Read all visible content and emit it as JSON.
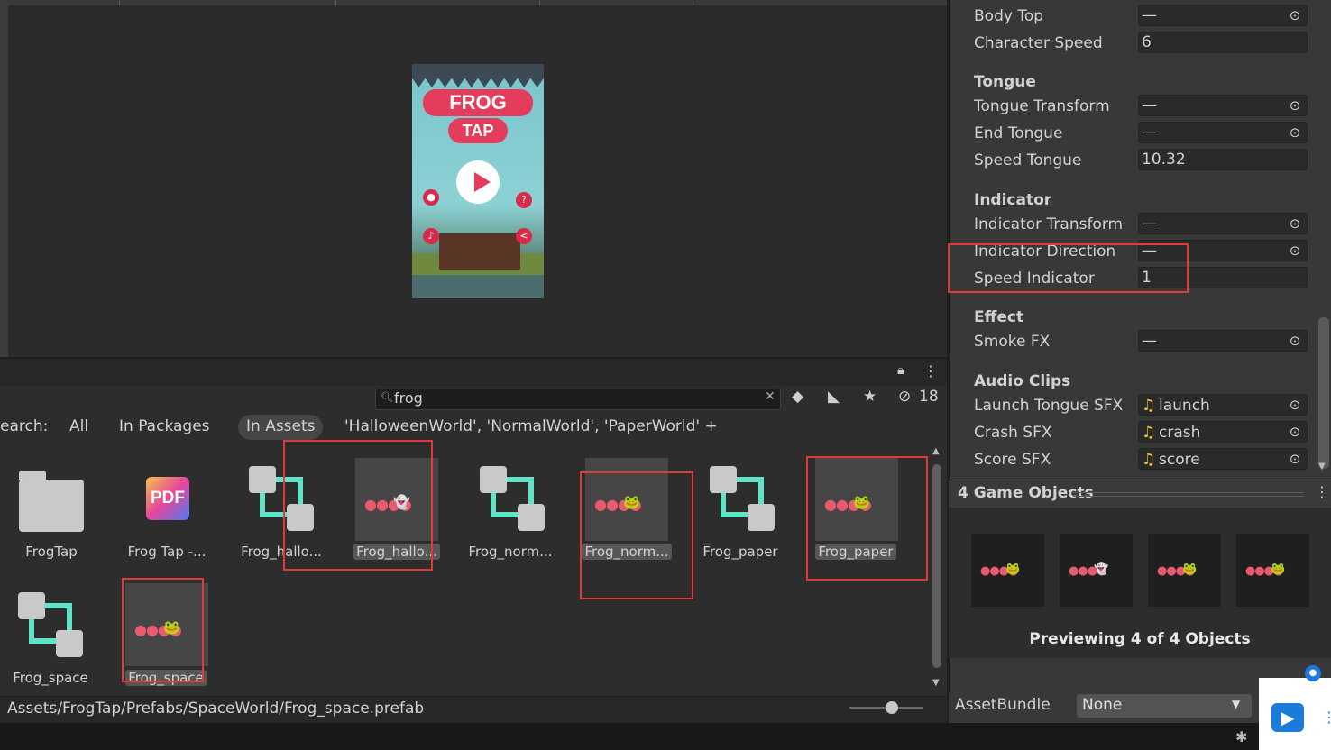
{
  "scene": {
    "game_title_line1": "FROG",
    "game_title_line2": "TAP"
  },
  "project": {
    "search_value": "frog",
    "hidden_count": "18",
    "filters": {
      "label": "earch:",
      "all": "All",
      "in_packages": "In Packages",
      "in_assets": "In Assets",
      "scenes": "'HalloweenWorld', 'NormalWorld', 'PaperWorld' +"
    },
    "items": [
      {
        "label": "FrogTap",
        "type": "folder-icon"
      },
      {
        "label": "Frog Tap -...",
        "type": "pdf-icon"
      },
      {
        "label": "Frog_hallo...",
        "type": "prefab-variant-icon"
      },
      {
        "label": "Frog_hallo...",
        "type": "prefab-thumbnail"
      },
      {
        "label": "Frog_norm...",
        "type": "prefab-variant-icon"
      },
      {
        "label": "Frog_norm...",
        "type": "prefab-thumbnail"
      },
      {
        "label": "Frog_paper",
        "type": "prefab-variant-icon"
      },
      {
        "label": "Frog_paper",
        "type": "prefab-thumbnail"
      },
      {
        "label": "Frog_space",
        "type": "prefab-variant-icon"
      },
      {
        "label": "Frog_space",
        "type": "prefab-thumbnail"
      }
    ],
    "path": "Assets/FrogTap/Prefabs/SpaceWorld/Frog_space.prefab",
    "pdf_text": "PDF"
  },
  "inspector": {
    "fields": {
      "body_top": {
        "label": "Body Top",
        "value": "—"
      },
      "character_speed": {
        "label": "Character Speed",
        "value": "6"
      },
      "tongue_header": "Tongue",
      "tongue_transform": {
        "label": "Tongue Transform",
        "value": "—"
      },
      "end_tongue": {
        "label": "End Tongue",
        "value": "—"
      },
      "speed_tongue": {
        "label": "Speed Tongue",
        "value": "10.32"
      },
      "indicator_header": "Indicator",
      "indicator_transform": {
        "label": "Indicator Transform",
        "value": "—"
      },
      "indicator_direction": {
        "label": "Indicator Direction",
        "value": "—"
      },
      "speed_indicator": {
        "label": "Speed Indicator",
        "value": "1"
      },
      "effect_header": "Effect",
      "smoke_fx": {
        "label": "Smoke FX",
        "value": "—"
      },
      "audio_header": "Audio Clips",
      "launch_tongue_sfx": {
        "label": "Launch Tongue SFX",
        "value": "launch"
      },
      "crash_sfx": {
        "label": "Crash SFX",
        "value": "crash"
      },
      "score_sfx": {
        "label": "Score SFX",
        "value": "score"
      }
    },
    "game_objects_title": "4 Game Objects",
    "preview_text": "Previewing 4 of 4 Objects",
    "assetbundle": {
      "label": "AssetBundle",
      "value": "None"
    }
  },
  "colors": {
    "highlight_box": "#e03a3a",
    "background": "#2d2d2d",
    "inspector_bg": "#383838"
  }
}
